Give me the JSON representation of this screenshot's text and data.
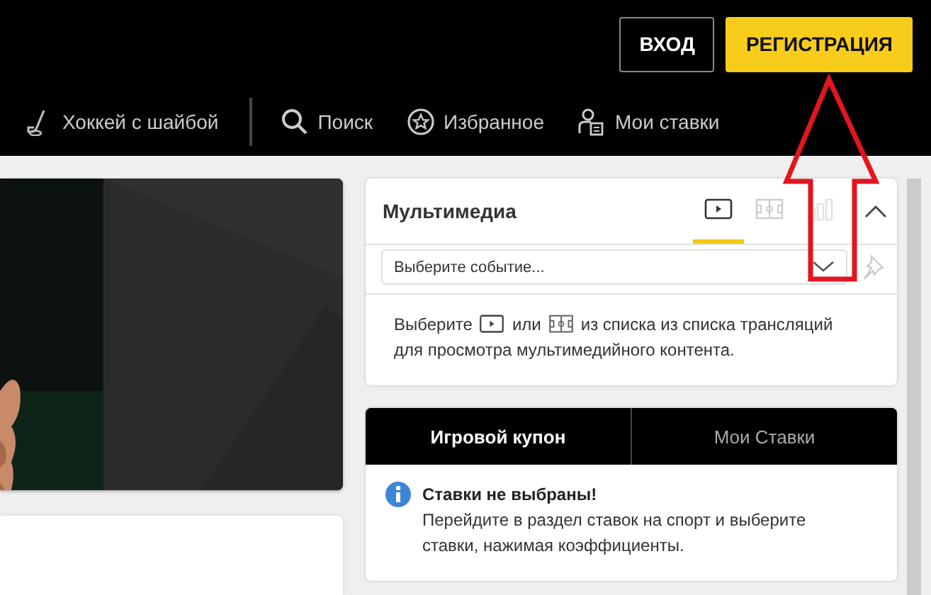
{
  "header": {
    "buttons": [
      {
        "label": "ВХОД",
        "kind": "outline"
      },
      {
        "label": "РЕГИСТРАЦИЯ",
        "kind": "primary"
      }
    ]
  },
  "nav": [
    {
      "label": "Хоккей с шайбой",
      "kind": "hockey"
    },
    {
      "label": "Поиск",
      "kind": "search"
    },
    {
      "label": "Избранное",
      "kind": "favorites"
    },
    {
      "label": "Мои ставки",
      "kind": "bets"
    }
  ],
  "multimedia": {
    "title": "Мультимедиа",
    "tabs": [
      {
        "kind": "video",
        "selected": true,
        "disabled": false
      },
      {
        "kind": "field",
        "selected": false,
        "disabled": false
      },
      {
        "kind": "stats",
        "selected": false,
        "disabled": true
      }
    ],
    "select": {
      "placeholder": "Выберите событие..."
    },
    "hint": {
      "before": "Выберите",
      "between": "или",
      "after": "из списка из списка трансляций",
      "line2": "для просмотра мультимедийного контента."
    }
  },
  "coupon": {
    "tabs": [
      {
        "label": "Игровой купон",
        "selected": true
      },
      {
        "label": "Мои Ставки",
        "selected": false
      }
    ],
    "notice": {
      "title": "Ставки не выбраны!",
      "text": "Перейдите в раздел ставок на спорт и выберите ставки, нажимая коэффициенты."
    }
  }
}
